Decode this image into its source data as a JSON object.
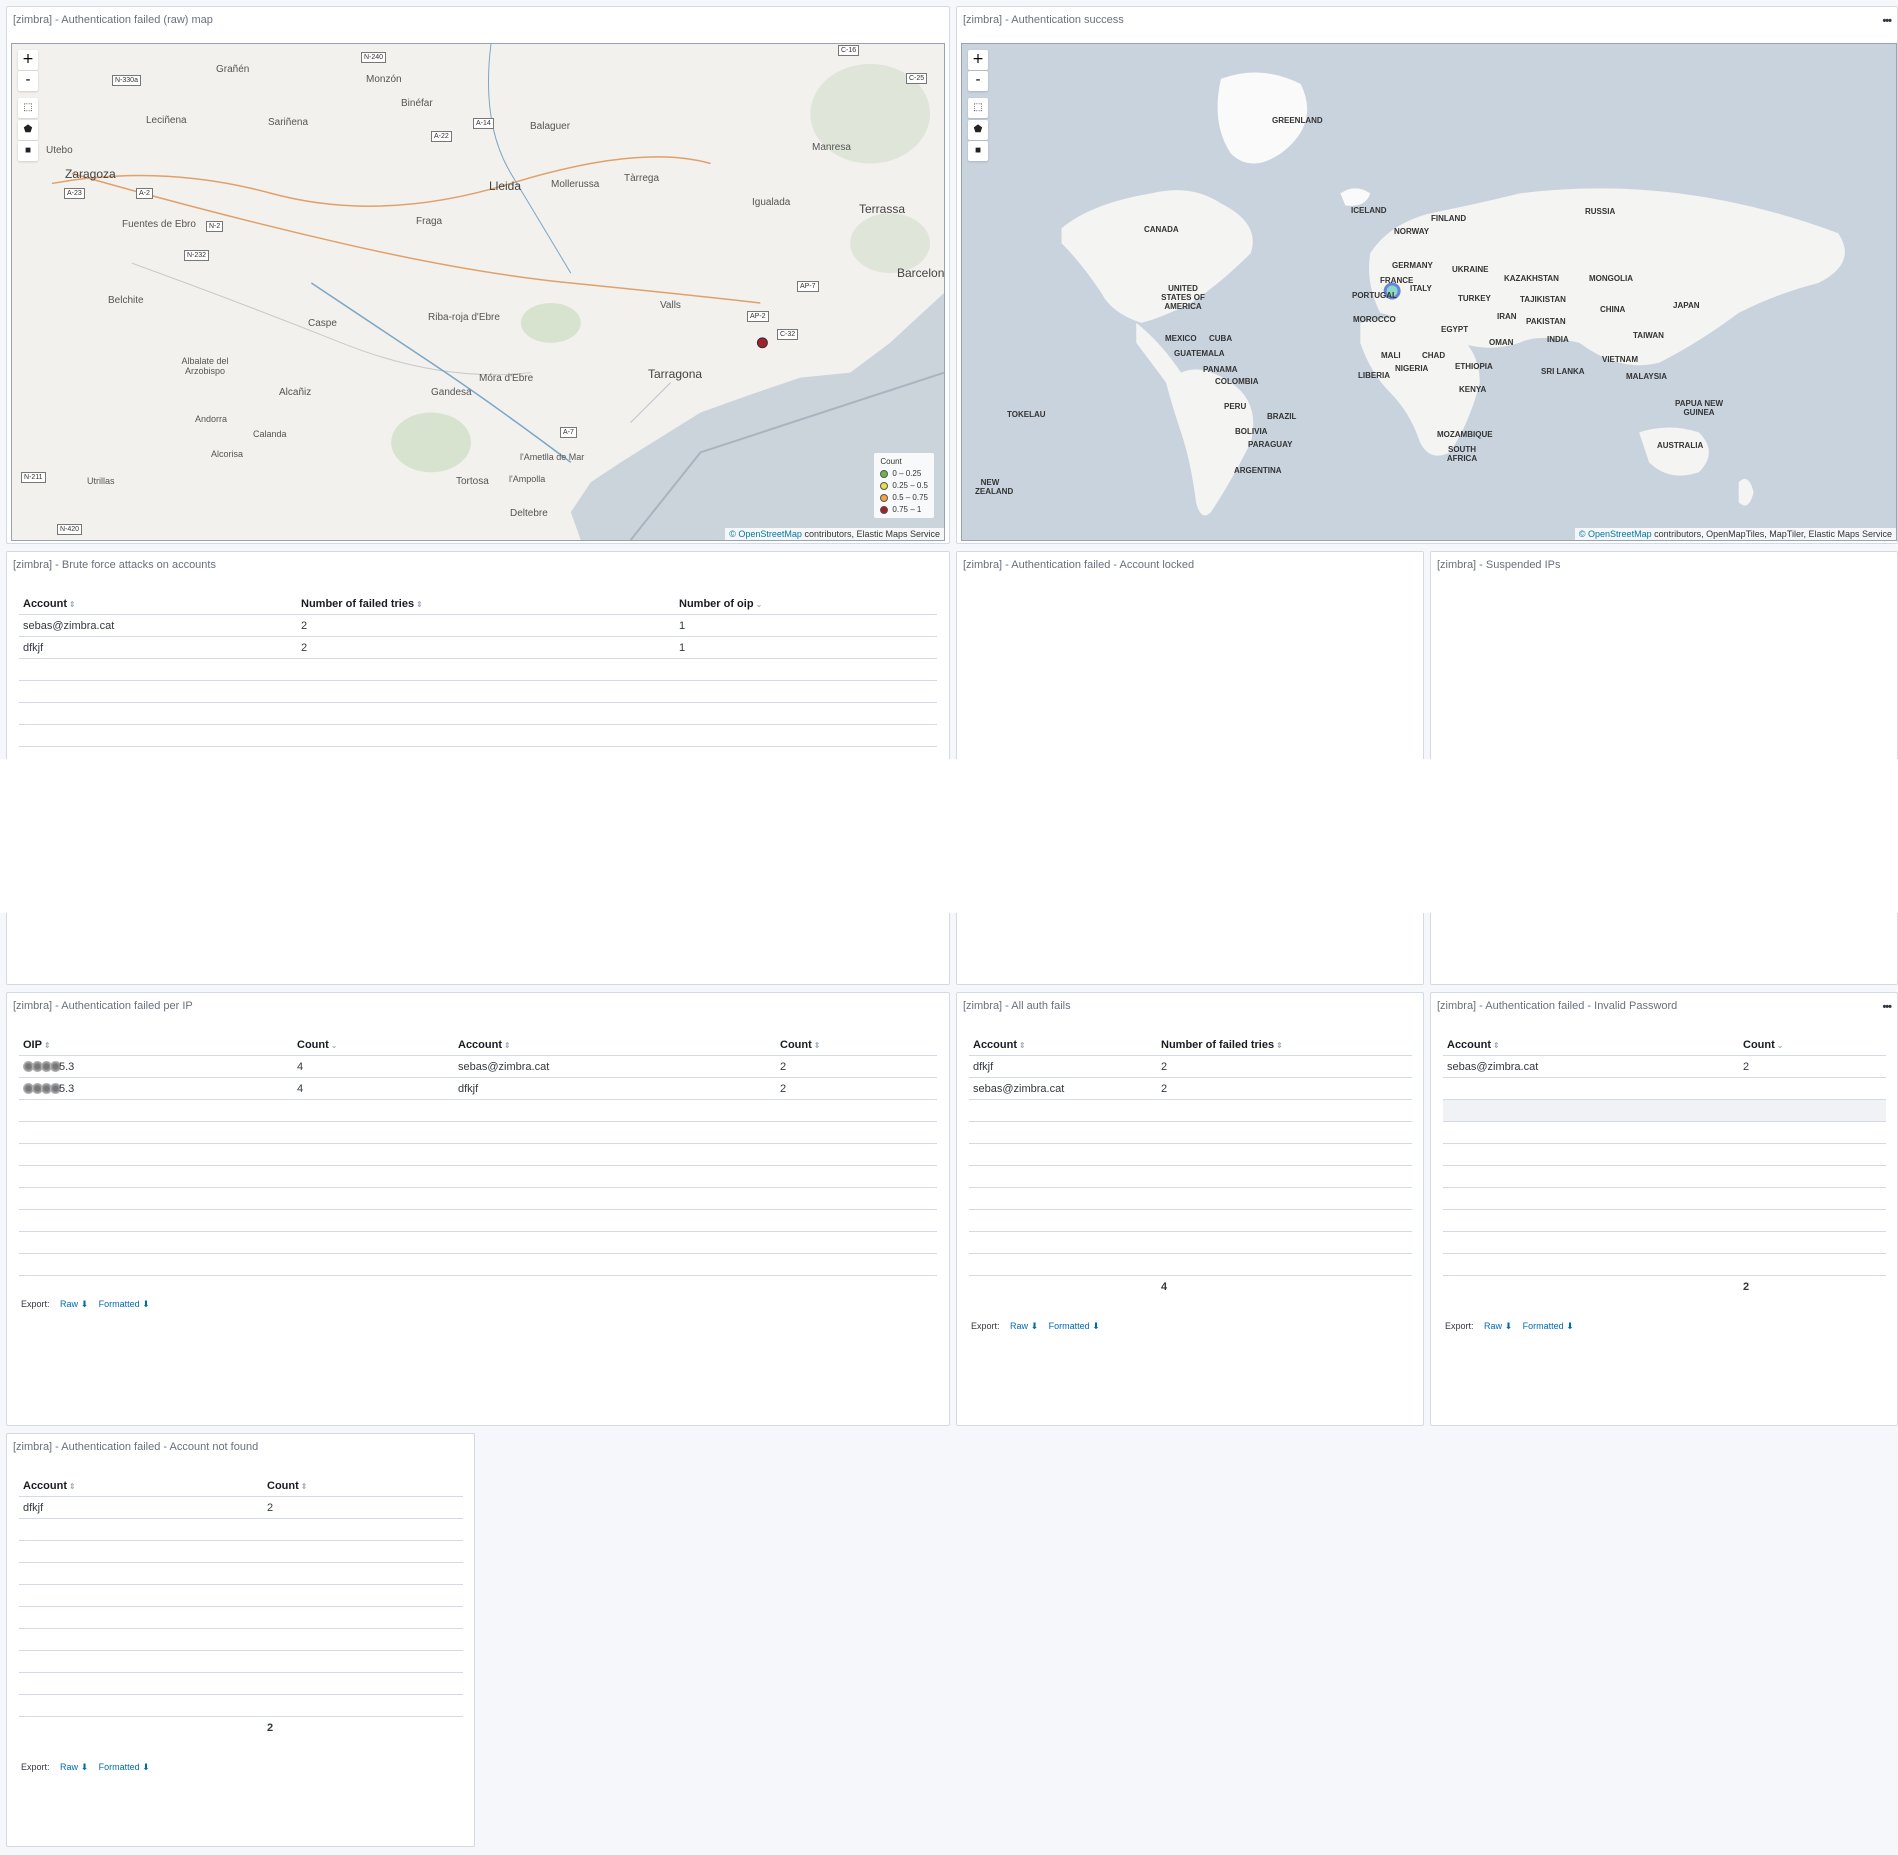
{
  "panels": {
    "raw_map": {
      "title": "[zimbra] - Authentication failed (raw) map",
      "zoom_in": "+",
      "zoom_out": "-",
      "legend_title": "Count",
      "legend": [
        {
          "label": "0 – 0.25",
          "color": "#6eb44e"
        },
        {
          "label": "0.25 – 0.5",
          "color": "#e6e04a"
        },
        {
          "label": "0.5 – 0.75",
          "color": "#f2a541"
        },
        {
          "label": "0.75 – 1",
          "color": "#a2202c"
        }
      ],
      "attribution_link": "© OpenStreetMap",
      "attribution_rest": " contributors, Elastic Maps Service",
      "places": [
        "Zaragoza",
        "Lleida",
        "Tarragona",
        "Terrassa",
        "Barcelona",
        "Manresa",
        "Igualada",
        "Tàrrega",
        "Mollerussa",
        "Balaguer",
        "Monzón",
        "Binéfar",
        "Sariñena",
        "Leciñena",
        "Grañén",
        "Utebo",
        "Fuentes de Ebro",
        "Fraga",
        "Belchite",
        "Caspe",
        "Riba-roja d'Ebre",
        "Valls",
        "Albalate del Arzobispo",
        "Alcañiz",
        "Gandesa",
        "Móra d'Ebre",
        "Andorra",
        "Calanda",
        "Alcorisa",
        "Utrillas",
        "Tortosa",
        "l'Ametlla de Mar",
        "l'Ampolla",
        "Deltebre"
      ],
      "roads": [
        "N-240",
        "N-330a",
        "A-22",
        "A-14",
        "C-16",
        "C-25",
        "A-23",
        "A-2",
        "N-2",
        "N-232",
        "AP-7",
        "AP-2",
        "C-32",
        "A-7",
        "N-211",
        "N-420"
      ],
      "point_color": "#a2202c"
    },
    "success_map": {
      "title": "[zimbra] - Authentication success",
      "menu": "•••",
      "zoom_in": "+",
      "zoom_out": "-",
      "attribution_link": "© OpenStreetMap",
      "attribution_rest": " contributors, OpenMapTiles, MapTiler, Elastic Maps Service",
      "countries": [
        "GREENLAND",
        "ICELAND",
        "RUSSIA",
        "FINLAND",
        "NORWAY",
        "CANADA",
        "GERMANY",
        "UKRAINE",
        "FRANCE",
        "KAZAKHSTAN",
        "MONGOLIA",
        "UNITED STATES OF AMERICA",
        "PORTUGAL",
        "ITALY",
        "TURKEY",
        "TAJIKISTAN",
        "CHINA",
        "JAPAN",
        "MOROCCO",
        "IRAN",
        "PAKISTAN",
        "EGYPT",
        "MEXICO",
        "CUBA",
        "GUATEMALA",
        "OMAN",
        "INDIA",
        "TAIWAN",
        "MALI",
        "CHAD",
        "NIGERIA",
        "ETHIOPIA",
        "SRI LANKA",
        "VIETNAM",
        "PANAMA",
        "COLOMBIA",
        "LIBERIA",
        "MALAYSIA",
        "KENYA",
        "TOKELAU",
        "PERU",
        "BRAZIL",
        "PAPUA NEW GUINEA",
        "BOLIVIA",
        "PARAGUAY",
        "MOZAMBIQUE",
        "SOUTH AFRICA",
        "AUSTRALIA",
        "ARGENTINA",
        "NEW ZEALAND"
      ],
      "point_color": "#7fd6c4"
    },
    "brute_force": {
      "title": "[zimbra] - Brute force attacks on accounts",
      "columns": [
        "Account",
        "Number of failed tries",
        "Number of oip"
      ],
      "rows": [
        [
          "sebas@zimbra.cat",
          "2",
          "1"
        ],
        [
          "dfkjf",
          "2",
          "1"
        ]
      ]
    },
    "account_locked": {
      "title": "[zimbra] - Authentication failed - Account locked"
    },
    "suspended_ips": {
      "title": "[zimbra] - Suspended IPs"
    },
    "failed_per_ip": {
      "title": "[zimbra] - Authentication failed per IP",
      "columns": [
        "OIP",
        "Count",
        "Account",
        "Count"
      ],
      "rows": [
        [
          "5.3",
          "4",
          "sebas@zimbra.cat",
          "2"
        ],
        [
          "5.3",
          "4",
          "dfkjf",
          "2"
        ]
      ],
      "export_label": "Export:",
      "raw_label": "Raw",
      "formatted_label": "Formatted"
    },
    "all_auth_fails": {
      "title": "[zimbra] - All auth fails",
      "columns": [
        "Account",
        "Number of failed tries"
      ],
      "rows": [
        [
          "dfkjf",
          "2"
        ],
        [
          "sebas@zimbra.cat",
          "2"
        ]
      ],
      "total": "4",
      "export_label": "Export:",
      "raw_label": "Raw",
      "formatted_label": "Formatted"
    },
    "invalid_password": {
      "title": "[zimbra] - Authentication failed - Invalid Password",
      "menu": "•••",
      "columns": [
        "Account",
        "Count"
      ],
      "rows": [
        [
          "sebas@zimbra.cat",
          "2"
        ]
      ],
      "total": "2",
      "export_label": "Export:",
      "raw_label": "Raw",
      "formatted_label": "Formatted"
    },
    "account_not_found": {
      "title": "[zimbra] - Authentication failed - Account not found",
      "columns": [
        "Account",
        "Count"
      ],
      "rows": [
        [
          "dfkjf",
          "2"
        ]
      ],
      "total": "2",
      "export_label": "Export:",
      "raw_label": "Raw",
      "formatted_label": "Formatted"
    }
  }
}
